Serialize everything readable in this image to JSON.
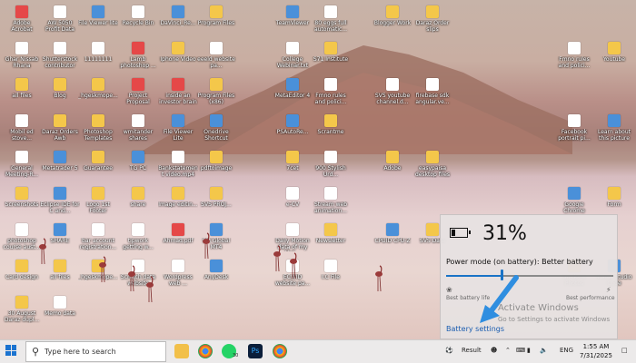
{
  "desktop": {
    "icons": [
      {
        "label": "Adobe Acrobat",
        "kind": "pdf"
      },
      {
        "label": "AW 5050 Profit Data",
        "kind": "doc"
      },
      {
        "label": "File Viewer lite",
        "kind": "app"
      },
      {
        "label": "Recycle Bin",
        "kind": "doc"
      },
      {
        "label": "DaVinci_Re...",
        "kind": "app"
      },
      {
        "label": "Program Files",
        "kind": "folder"
      },
      {
        "label": "TeamViewer",
        "kind": "app"
      },
      {
        "label": "80 eggs full automatic...",
        "kind": "doc"
      },
      {
        "label": "Blogger Work",
        "kind": "folder"
      },
      {
        "label": "Daraz Order slips",
        "kind": "folder"
      },
      {
        "label": "Ghar Nissab Rhana",
        "kind": "doc"
      },
      {
        "label": "Shutterstock contributor",
        "kind": "doc"
      },
      {
        "label": "11111111",
        "kind": "doc"
      },
      {
        "label": "Lamb photoshop ...",
        "kind": "pdf"
      },
      {
        "label": "Iphone Video",
        "kind": "folder"
      },
      {
        "label": "eeeld website pa...",
        "kind": "doc"
      },
      {
        "label": "College Webinar.txt",
        "kind": "doc"
      },
      {
        "label": "S71 Institute",
        "kind": "folder"
      },
      {
        "label": "Fmno rules and polici...",
        "kind": "doc"
      },
      {
        "label": "Youtube",
        "kind": "folder"
      },
      {
        "label": "all files",
        "kind": "folder"
      },
      {
        "label": "Blog",
        "kind": "folder"
      },
      {
        "label": "_hgeskmope...",
        "kind": "folder"
      },
      {
        "label": "Project Proposal",
        "kind": "pdf"
      },
      {
        "label": "inside an investor brain",
        "kind": "pdf"
      },
      {
        "label": "Program Files (x86)",
        "kind": "folder"
      },
      {
        "label": "MetaEditor 4",
        "kind": "app"
      },
      {
        "label": "Fmno rules and polici...",
        "kind": "doc"
      },
      {
        "label": "SVS youtube channel.d...",
        "kind": "doc"
      },
      {
        "label": "firebase sdk angular.ve...",
        "kind": "doc"
      },
      {
        "label": "Mobil ed stove...",
        "kind": "doc"
      },
      {
        "label": "Daraz Orders Awb",
        "kind": "folder"
      },
      {
        "label": "Photoshop Templates",
        "kind": "folder"
      },
      {
        "label": "wmitander shares",
        "kind": "doc"
      },
      {
        "label": "File Viewer Lite",
        "kind": "app"
      },
      {
        "label": "Onedrive Shortcut",
        "kind": "app"
      },
      {
        "label": "PSAutoRe...",
        "kind": "app"
      },
      {
        "label": "Scrantme",
        "kind": "folder"
      },
      {
        "label": "Facebook portrait pi...",
        "kind": "doc"
      },
      {
        "label": "Learn about this picture",
        "kind": "app"
      },
      {
        "label": "General Meeting-R...",
        "kind": "doc"
      },
      {
        "label": "Metatrader 5",
        "kind": "app"
      },
      {
        "label": "Guarantee",
        "kind": "folder"
      },
      {
        "label": "TG PC",
        "kind": "app"
      },
      {
        "label": "Bankstatement video.mp4",
        "kind": "doc"
      },
      {
        "label": "pdftoimage",
        "kind": "folder"
      },
      {
        "label": "7cet",
        "kind": "folder"
      },
      {
        "label": "900 Stylish Urd...",
        "kind": "doc"
      },
      {
        "label": "Adobe",
        "kind": "folder"
      },
      {
        "label": "easypaisa desktop files",
        "kind": "folder"
      },
      {
        "label": "Screenshots",
        "kind": "folder"
      },
      {
        "label": "Eclipse IDE for C and...",
        "kind": "app"
      },
      {
        "label": "Logo 1st Footer",
        "kind": "folder"
      },
      {
        "label": "share",
        "kind": "folder"
      },
      {
        "label": "Image editin...",
        "kind": "folder"
      },
      {
        "label": "SVS PROJ...",
        "kind": "folder"
      },
      {
        "label": "e-CV",
        "kind": "doc"
      },
      {
        "label": "Stream web animation...",
        "kind": "doc"
      },
      {
        "label": "Google Chrome",
        "kind": "app"
      },
      {
        "label": "Form",
        "kind": "folder"
      },
      {
        "label": "photoshop course aust...",
        "kind": "doc"
      },
      {
        "label": "SHARE",
        "kind": "app"
      },
      {
        "label": "bar account registration...",
        "kind": "doc"
      },
      {
        "label": "tipwork getting w...",
        "kind": "doc"
      },
      {
        "label": "Ahmad.pdf",
        "kind": "pdf"
      },
      {
        "label": "SM Global MT4",
        "kind": "app"
      },
      {
        "label": "Daily Motion data of my Mot...",
        "kind": "doc"
      },
      {
        "label": "Newsletter",
        "kind": "folder"
      },
      {
        "label": "CPUID CPU-Z",
        "kind": "app"
      },
      {
        "label": "SVS Data",
        "kind": "folder"
      },
      {
        "label": "Card design",
        "kind": "folder"
      },
      {
        "label": "all files",
        "kind": "folder"
      },
      {
        "label": "_hgeskmope...",
        "kind": "folder"
      },
      {
        "label": "Scratch data website",
        "kind": "doc"
      },
      {
        "label": "Wordpress web ...",
        "kind": "doc"
      },
      {
        "label": "AnyDesk",
        "kind": "app"
      },
      {
        "label": "ECWID website pa...",
        "kind": "doc"
      },
      {
        "label": "I.C File",
        "kind": "doc"
      },
      {
        "label": "Smdone Photos",
        "kind": "folder"
      },
      {
        "label": "Visual Studio Code",
        "kind": "app"
      },
      {
        "label": "30 August Daraz dupl...",
        "kind": "folder"
      },
      {
        "label": "Memo data",
        "kind": "doc"
      }
    ]
  },
  "battery_flyout": {
    "percent_text": "31%",
    "percent_value": 31,
    "power_mode_label": "Power mode (on battery): Better battery",
    "slider_value": 0.33,
    "left_label": "Best battery life",
    "right_label": "Best performance",
    "left_icon": "leaf-icon",
    "right_icon": "bolt-icon",
    "settings_link": "Battery settings"
  },
  "watermark": {
    "line1": "Activate Windows",
    "line2": "Go to Settings to activate Windows"
  },
  "taskbar": {
    "search_placeholder": "Type here to search",
    "apps": [
      "file-explorer-icon",
      "chrome-icon",
      "whatsapp-icon",
      "photoshop-icon",
      "chrome-icon"
    ],
    "whatsapp_badge": "30",
    "news_text": "Result",
    "language": "ENG",
    "time": "1:55 AM",
    "date": "7/31/2025"
  },
  "colors": {
    "accent": "#1a73c6",
    "flyout_bg": "#e6e1e1",
    "taskbar_bg": "#eceaea"
  }
}
